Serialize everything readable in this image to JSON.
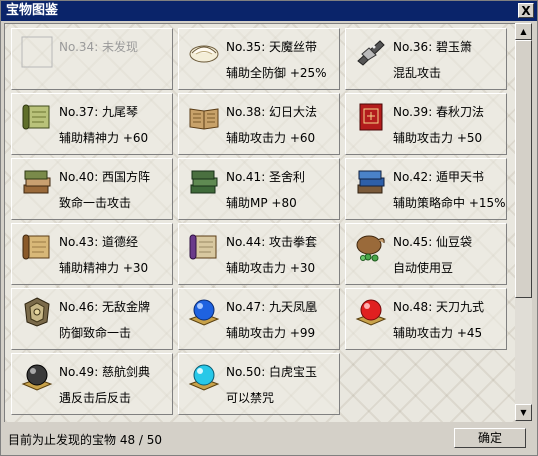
{
  "window": {
    "title": "宝物图鉴",
    "close_label": "X"
  },
  "items": [
    {
      "no": "No.34: 未发现",
      "effect": "",
      "icon": "empty-slot-icon",
      "discovered": false
    },
    {
      "no": "No.35: 天魔丝带",
      "effect": "辅助全防御 +25%",
      "icon": "silk-ribbon-icon",
      "discovered": true
    },
    {
      "no": "No.36: 碧玉箫",
      "effect": "混乱攻击",
      "icon": "jade-flute-icon",
      "discovered": true
    },
    {
      "no": "No.37: 九尾琴",
      "effect": "辅助精神力 +60",
      "icon": "green-scroll-icon",
      "discovered": true
    },
    {
      "no": "No.38: 幻日大法",
      "effect": "辅助攻击力 +60",
      "icon": "open-book-icon",
      "discovered": true
    },
    {
      "no": "No.39: 春秋刀法",
      "effect": "辅助攻击力 +50",
      "icon": "red-book-icon",
      "discovered": true
    },
    {
      "no": "No.40: 西国方阵",
      "effect": "致命一击攻击",
      "icon": "book-stack-icon",
      "discovered": true
    },
    {
      "no": "No.41: 圣舍利",
      "effect": "辅助MP +80",
      "icon": "green-book-stack-icon",
      "discovered": true
    },
    {
      "no": "No.42: 遁甲天书",
      "effect": "辅助策略命中 +15%",
      "icon": "blue-book-stack-icon",
      "discovered": true
    },
    {
      "no": "No.43: 道德经",
      "effect": "辅助精神力 +30",
      "icon": "tan-scroll-icon",
      "discovered": true
    },
    {
      "no": "No.44: 攻击拳套",
      "effect": "辅助攻击力 +30",
      "icon": "purple-scroll-icon",
      "discovered": true
    },
    {
      "no": "No.45: 仙豆袋",
      "effect": "自动使用豆",
      "icon": "bean-bag-icon",
      "discovered": true
    },
    {
      "no": "No.46: 无敌金牌",
      "effect": "防御致命一击",
      "icon": "armor-plate-icon",
      "discovered": true
    },
    {
      "no": "No.47: 九天凤凰",
      "effect": "辅助攻击力 +99",
      "icon": "blue-orb-icon",
      "discovered": true
    },
    {
      "no": "No.48: 天刀九式",
      "effect": "辅助攻击力 +45",
      "icon": "red-orb-icon",
      "discovered": true
    },
    {
      "no": "No.49: 慈航剑典",
      "effect": "遇反击后反击",
      "icon": "black-orb-icon",
      "discovered": true
    },
    {
      "no": "No.50: 白虎宝玉",
      "effect": "可以禁咒",
      "icon": "cyan-orb-icon",
      "discovered": true
    }
  ],
  "status": {
    "found_text": "目前为止发现的宝物 48 / 50"
  },
  "ok_button": {
    "label": "确定"
  },
  "scrollbar": {
    "up_icon": "▲",
    "down_icon": "▼"
  },
  "colors": {
    "titlebar": "#0a246a",
    "panel": "#d4d0c8",
    "content_bg": "#e9e7df"
  }
}
